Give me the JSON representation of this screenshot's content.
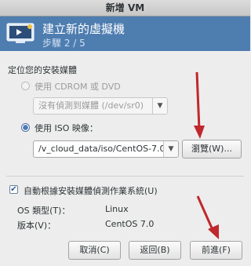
{
  "window": {
    "title": "新增 VM"
  },
  "banner": {
    "title": "建立新的虛擬機",
    "step": "步驟 2 / 5"
  },
  "section": {
    "label": "定位您的安裝媒體"
  },
  "options": {
    "cdrom_label": "使用 CDROM 或 DVD",
    "cdrom_combo_value": "沒有偵測到媒體 (/dev/sr0)",
    "iso_label": "使用 ISO 映像：",
    "iso_path_value": "/v_cloud_data/iso/CentOS-7.0",
    "browse_button": "瀏覽(W)..."
  },
  "auto_detect": {
    "label": "自動根據安裝媒體偵測作業系統(U)",
    "checked": true
  },
  "os_info": {
    "type_label": "OS 類型(T)：",
    "type_value": "Linux",
    "version_label": "版本(V)：",
    "version_value": "CentOS 7.0"
  },
  "footer": {
    "cancel_button": "取消(C)",
    "back_button": "返回(B)",
    "forward_button": "前進(F)"
  },
  "colors": {
    "banner": "#4e7db0",
    "annotation_arrow": "#c0282d"
  }
}
